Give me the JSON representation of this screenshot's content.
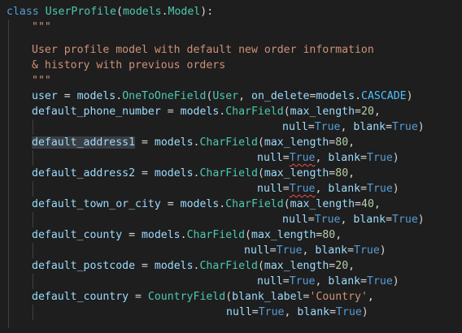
{
  "code": {
    "class_keyword": "class",
    "class_name": "UserProfile",
    "base_module": "models",
    "base_class": "Model",
    "docstring_quotes": "\"\"\"",
    "docstring_line1": "User profile model with default new order information",
    "docstring_line2": "& history with previous orders",
    "fields": {
      "user": "user",
      "default_phone_number": "default_phone_number",
      "default_address1": "default_address1",
      "default_address2": "default_address2",
      "default_town_or_city": "default_town_or_city",
      "default_county": "default_county",
      "default_postcode": "default_postcode",
      "default_country": "default_country"
    },
    "models": "models",
    "OneToOneField": "OneToOneField",
    "CharField": "CharField",
    "CountryField": "CountryField",
    "User": "User",
    "on_delete": "on_delete",
    "CASCADE": "CASCADE",
    "max_length": "max_length",
    "null": "null",
    "blank": "blank",
    "True": "True",
    "blank_label": "blank_label",
    "country_label": "'Country'",
    "lengths": {
      "phone": "20",
      "address1": "80",
      "address2": "80",
      "town": "40",
      "county": "80",
      "postcode": "20"
    }
  }
}
